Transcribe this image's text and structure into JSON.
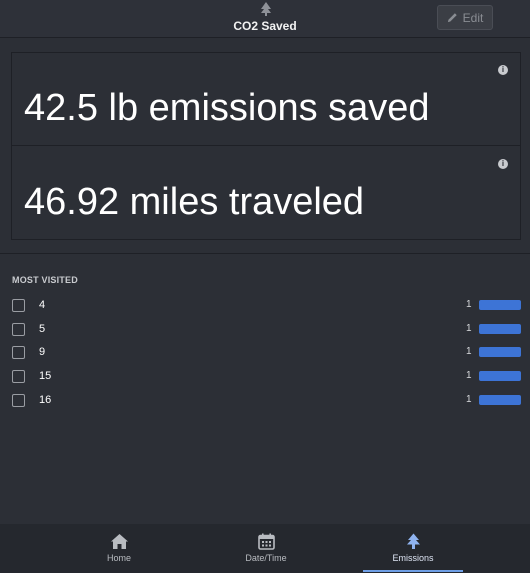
{
  "header": {
    "title": "CO2 Saved",
    "logo_icon": "tree-icon",
    "edit_label": "Edit",
    "edit_icon": "pencil-icon"
  },
  "stats": {
    "emissions_saved": "42.5 lb emissions saved",
    "miles_traveled": "46.92 miles traveled",
    "info_icon": "info-icon"
  },
  "most_visited": {
    "title": "MOST VISITED",
    "items": [
      {
        "label": "4",
        "count": "1",
        "fraction": 1.0
      },
      {
        "label": "5",
        "count": "1",
        "fraction": 1.0
      },
      {
        "label": "9",
        "count": "1",
        "fraction": 1.0
      },
      {
        "label": "15",
        "count": "1",
        "fraction": 1.0
      },
      {
        "label": "16",
        "count": "1",
        "fraction": 1.0
      }
    ],
    "bar_color": "#3d74d6"
  },
  "nav": {
    "tabs": [
      {
        "label": "Home",
        "icon": "home-icon"
      },
      {
        "label": "Date/Time",
        "icon": "calendar-icon"
      },
      {
        "label": "Emissions",
        "icon": "tree-icon",
        "active": true
      }
    ],
    "accent": "#6f9fe6"
  }
}
